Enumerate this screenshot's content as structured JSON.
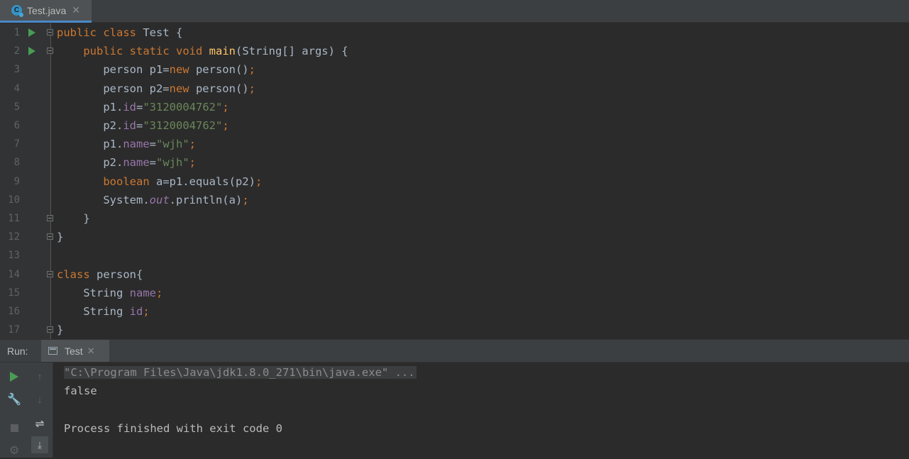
{
  "tab": {
    "label": "Test.java",
    "icon": "java-class-icon",
    "icon_letter": "C",
    "close": "✕"
  },
  "code_lines": [
    {
      "n": "1",
      "run": true,
      "fold": true,
      "tokens": [
        [
          "kw",
          "public "
        ],
        [
          "kw",
          "class "
        ],
        [
          "p",
          "Test {"
        ]
      ]
    },
    {
      "n": "2",
      "run": true,
      "fold": true,
      "tokens": [
        [
          "p",
          "    "
        ],
        [
          "kw",
          "public "
        ],
        [
          "kw",
          "static "
        ],
        [
          "kw",
          "void "
        ],
        [
          "fn",
          "main"
        ],
        [
          "p",
          "(String[] args) {"
        ]
      ]
    },
    {
      "n": "3",
      "tokens": [
        [
          "p",
          "       person p1="
        ],
        [
          "kw",
          "new "
        ],
        [
          "p",
          "person()"
        ],
        [
          "kw",
          ";"
        ]
      ]
    },
    {
      "n": "4",
      "tokens": [
        [
          "p",
          "       person p2="
        ],
        [
          "kw",
          "new "
        ],
        [
          "p",
          "person()"
        ],
        [
          "kw",
          ";"
        ]
      ]
    },
    {
      "n": "5",
      "tokens": [
        [
          "p",
          "       p1."
        ],
        [
          "fld",
          "id"
        ],
        [
          "p",
          "="
        ],
        [
          "str",
          "\"3120004762\""
        ],
        [
          "kw",
          ";"
        ]
      ]
    },
    {
      "n": "6",
      "tokens": [
        [
          "p",
          "       p2."
        ],
        [
          "fld",
          "id"
        ],
        [
          "p",
          "="
        ],
        [
          "str",
          "\"3120004762\""
        ],
        [
          "kw",
          ";"
        ]
      ]
    },
    {
      "n": "7",
      "tokens": [
        [
          "p",
          "       p1."
        ],
        [
          "fld",
          "name"
        ],
        [
          "p",
          "="
        ],
        [
          "str",
          "\"wjh\""
        ],
        [
          "kw",
          ";"
        ]
      ]
    },
    {
      "n": "8",
      "tokens": [
        [
          "p",
          "       p2."
        ],
        [
          "fld",
          "name"
        ],
        [
          "p",
          "="
        ],
        [
          "str",
          "\"wjh\""
        ],
        [
          "kw",
          ";"
        ]
      ]
    },
    {
      "n": "9",
      "tokens": [
        [
          "p",
          "       "
        ],
        [
          "kw",
          "boolean "
        ],
        [
          "p",
          "a=p1.equals(p2)"
        ],
        [
          "kw",
          ";"
        ]
      ]
    },
    {
      "n": "10",
      "tokens": [
        [
          "p",
          "       System."
        ],
        [
          "stat",
          "out"
        ],
        [
          "p",
          ".println(a)"
        ],
        [
          "kw",
          ";"
        ]
      ]
    },
    {
      "n": "11",
      "fold": true,
      "tokens": [
        [
          "p",
          "    }"
        ]
      ]
    },
    {
      "n": "12",
      "fold": true,
      "tokens": [
        [
          "p",
          "}"
        ]
      ]
    },
    {
      "n": "13",
      "tokens": []
    },
    {
      "n": "14",
      "fold": true,
      "tokens": [
        [
          "kw",
          "class "
        ],
        [
          "p",
          "person{"
        ]
      ]
    },
    {
      "n": "15",
      "tokens": [
        [
          "p",
          "    String "
        ],
        [
          "fld",
          "name"
        ],
        [
          "kw",
          ";"
        ]
      ]
    },
    {
      "n": "16",
      "tokens": [
        [
          "p",
          "    String "
        ],
        [
          "fld",
          "id"
        ],
        [
          "kw",
          ";"
        ]
      ]
    },
    {
      "n": "17",
      "fold": true,
      "tokens": [
        [
          "p",
          "}"
        ]
      ]
    }
  ],
  "run_panel": {
    "label": "Run:",
    "tab_label": "Test",
    "tab_close": "✕",
    "tools": [
      "rerun-icon",
      "wrench-icon",
      "stop-icon",
      "gear-icon",
      "up-arrow-icon",
      "down-arrow-icon",
      "soft-wrap-icon",
      "scroll-to-end-icon"
    ]
  },
  "console": {
    "command": "\"C:\\Program Files\\Java\\jdk1.8.0_271\\bin\\java.exe\" ...",
    "output": "false",
    "blank": "",
    "finish": "Process finished with exit code 0"
  }
}
